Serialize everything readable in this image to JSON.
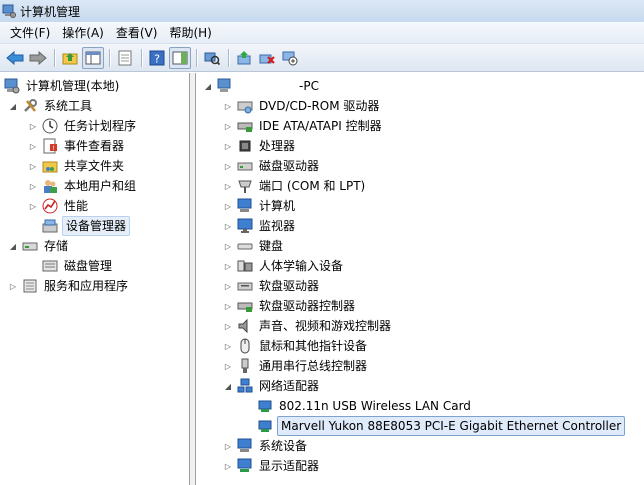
{
  "window": {
    "title": "计算机管理"
  },
  "menubar": {
    "file": "文件(F)",
    "action": "操作(A)",
    "view": "查看(V)",
    "help": "帮助(H)"
  },
  "left_tree": {
    "root": "计算机管理(本地)",
    "system_tools": "系统工具",
    "task_scheduler": "任务计划程序",
    "event_viewer": "事件查看器",
    "shared_folders": "共享文件夹",
    "local_users": "本地用户和组",
    "performance": "性能",
    "device_manager": "设备管理器",
    "storage": "存储",
    "disk_management": "磁盘管理",
    "services_apps": "服务和应用程序"
  },
  "device_tree": {
    "computer_name": "-PC",
    "categories": [
      "DVD/CD-ROM 驱动器",
      "IDE ATA/ATAPI 控制器",
      "处理器",
      "磁盘驱动器",
      "端口 (COM 和 LPT)",
      "计算机",
      "监视器",
      "键盘",
      "人体学输入设备",
      "软盘驱动器",
      "软盘驱动器控制器",
      "声音、视频和游戏控制器",
      "鼠标和其他指针设备",
      "通用串行总线控制器",
      "网络适配器"
    ],
    "network_adapters": [
      "802.11n USB Wireless LAN Card",
      "Marvell Yukon 88E8053 PCI-E Gigabit Ethernet Controller"
    ],
    "after": [
      "系统设备",
      "显示适配器"
    ]
  }
}
